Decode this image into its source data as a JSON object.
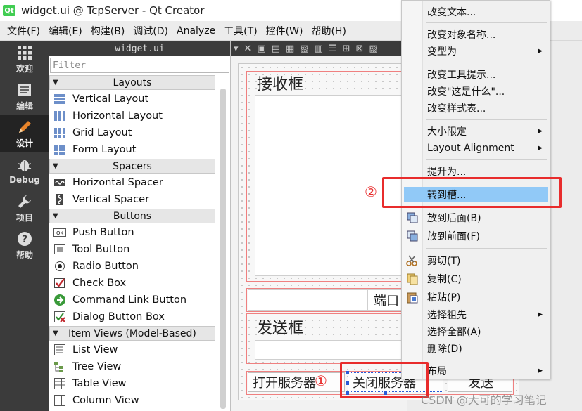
{
  "window": {
    "title": "widget.ui @ TcpServer - Qt Creator",
    "logo_text": "Qt"
  },
  "menubar": [
    "文件(F)",
    "编辑(E)",
    "构建(B)",
    "调试(D)",
    "Analyze",
    "工具(T)",
    "控件(W)",
    "帮助(H)"
  ],
  "modes": [
    {
      "label": "欢迎",
      "icon": "grid-icon"
    },
    {
      "label": "编辑",
      "icon": "document-icon"
    },
    {
      "label": "设计",
      "icon": "pencil-icon"
    },
    {
      "label": "Debug",
      "icon": "bug-icon"
    },
    {
      "label": "项目",
      "icon": "wrench-icon"
    },
    {
      "label": "帮助",
      "icon": "help-icon"
    }
  ],
  "widgetbox": {
    "file_tab": "widget.ui",
    "filter_placeholder": "Filter",
    "categories": {
      "layouts": "Layouts",
      "spacers": "Spacers",
      "buttons": "Buttons",
      "item_views": "Item Views (Model-Based)"
    },
    "items": {
      "vertical_layout": "Vertical Layout",
      "horizontal_layout": "Horizontal Layout",
      "grid_layout": "Grid Layout",
      "form_layout": "Form Layout",
      "horizontal_spacer": "Horizontal Spacer",
      "vertical_spacer": "Vertical Spacer",
      "push_button": "Push Button",
      "tool_button": "Tool Button",
      "radio_button": "Radio Button",
      "check_box": "Check Box",
      "command_link_button": "Command Link Button",
      "dialog_button_box": "Dialog Button Box",
      "list_view": "List View",
      "tree_view": "Tree View",
      "table_view": "Table View",
      "column_view": "Column View"
    },
    "pushbutton_icon_text": "OK"
  },
  "form": {
    "receive_group_title": "接收框",
    "port_label": "端口",
    "send_group_title": "发送框",
    "open_server_button": "打开服务器",
    "close_server_button": "关闭服务器",
    "send_button": "发送"
  },
  "context_menu": {
    "change_text": "改变文本...",
    "change_object_name": "改变对象名称...",
    "morph_into": "变型为",
    "change_tooltip": "改变工具提示...",
    "change_whats_this": "改变\"这是什么\"...",
    "change_stylesheet": "改变样式表...",
    "size_constraints": "大小限定",
    "layout_alignment": "Layout Alignment",
    "promote_to": "提升为...",
    "go_to_slot": "转到槽...",
    "send_to_back": "放到后面(B)",
    "bring_to_front": "放到前面(F)",
    "cut": "剪切(T)",
    "copy": "复制(C)",
    "paste": "粘贴(P)",
    "select_ancestor": "选择祖先",
    "select_all": "选择全部(A)",
    "delete": "删除(D)",
    "layout": "布局"
  },
  "annotations": {
    "step1": "①",
    "step2": "②",
    "color": "#e82c2c"
  },
  "watermark": "CSDN @大可的学习笔记",
  "colors": {
    "selection": "#91c9f7",
    "modebar": "#3b3b3b",
    "form_frame": "#ef8080"
  }
}
